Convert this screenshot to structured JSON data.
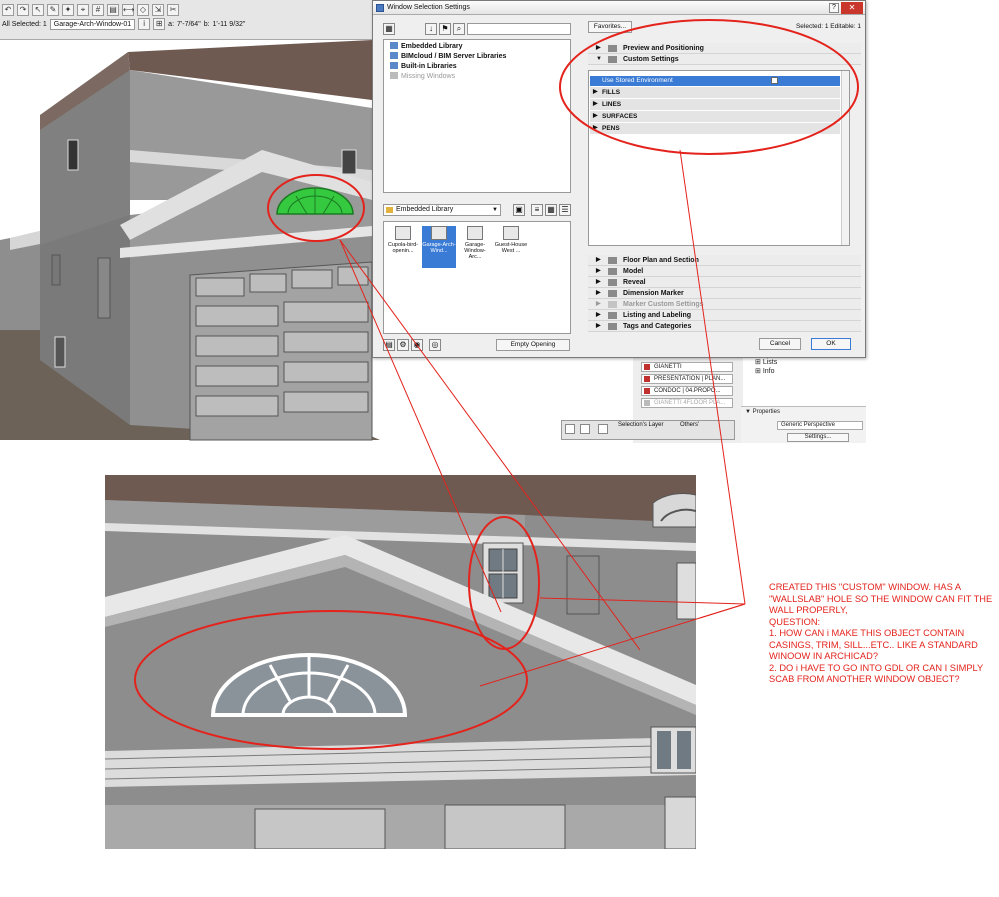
{
  "toolbar": {
    "selection_info": "All Selected: 1",
    "element_name": "Garage-Arch-Window-01",
    "dim_a_label": "a:",
    "dim_a_value": "7'-7/64\"",
    "dim_b_label": "b:",
    "dim_b_value": "1'-11 9/32\""
  },
  "dialog": {
    "title": "Window Selection Settings",
    "help": "?",
    "close": "✕",
    "library_tree": [
      "Embedded Library",
      "BIMcloud / BIM Server Libraries",
      "Built-in Libraries",
      "Missing Windows"
    ],
    "folder_combo": "Embedded Library",
    "thumbnails": [
      "Cupola-bird-openin...",
      "Garage-Arch-Wind...",
      "Garage-Window-Arc...",
      "Guest-House West ..."
    ],
    "empty_opening": "Empty Opening",
    "favorites": "Favorites...",
    "selected_editable": "Selected: 1 Editable: 1",
    "sections_top": [
      "Preview and Positioning",
      "Custom Settings"
    ],
    "use_stored": "Use Stored Environment",
    "subsections": [
      "FILLS",
      "LINES",
      "SURFACES",
      "PENS"
    ],
    "sections_bottom": [
      "Floor Plan and Section",
      "Model",
      "Reveal",
      "Dimension Marker",
      "Marker Custom Settings",
      "Listing and Labeling",
      "Tags and Categories"
    ],
    "cancel": "Cancel",
    "ok": "OK"
  },
  "navigator": {
    "items": [
      "GIANETTI",
      "PRESENTATION | PLAN...",
      "CONDOC | 04.PROPO...",
      "GIANETTI 4FLOOR PLA..."
    ],
    "tree_items": [
      "Lists",
      "Info"
    ],
    "properties_label": "Properties",
    "view_name": "Generic Perspective",
    "settings_button": "Settings..."
  },
  "status_bar": {
    "layer_label": "Selection's Layer",
    "others_label": "Others'"
  },
  "annotation": {
    "color": "#e3231c",
    "note": "CREATED THIS \"CUSTOM\" WINDOW. HAS A \"WALLSLAB\" HOLE SO THE WINDOW CAN FIT THE WALL PROPERLY,\nQUESTION:\n1. HOW CAN i MAKE THIS OBJECT CONTAIN CASINGS, TRIM, SILL...ETC.. LIKE A STANDARD WINOOW IN ARCHICAD?\n2. DO i HAVE TO GO INTO GDL OR CAN I SIMPLY SCAB FROM ANOTHER WINDOW OBJECT?"
  },
  "colors": {
    "highlight_green": "#35c93f",
    "selection_blue": "#3a7bd5",
    "wall_gray": "#8d8d8d",
    "roof_brown": "#6f5a52"
  }
}
